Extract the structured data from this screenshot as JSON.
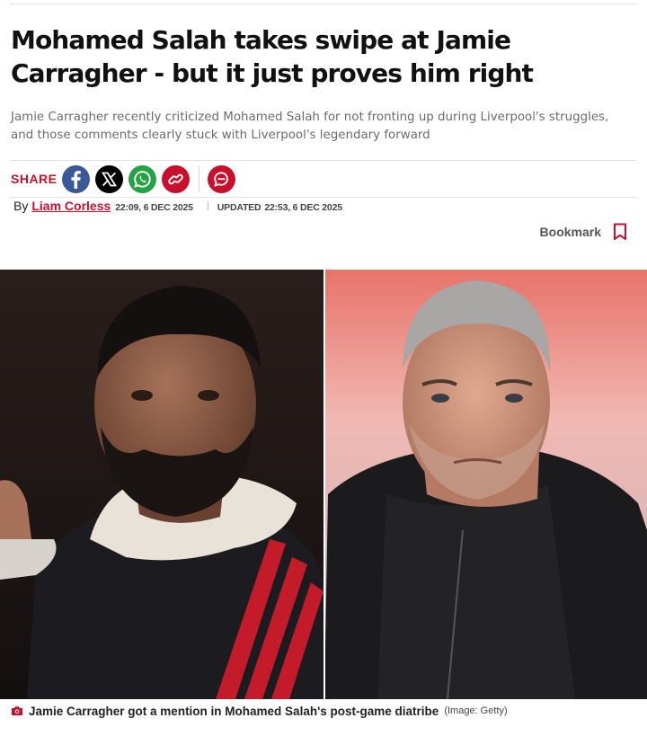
{
  "article": {
    "headline": "Mohamed Salah takes swipe at Jamie Carragher - but it just proves him right",
    "standfirst": "Jamie Carragher recently criticized Mohamed Salah for not fronting up during Liverpool's struggles, and those comments clearly stuck with Liverpool's legendary forward"
  },
  "share": {
    "label": "SHARE",
    "buttons": [
      {
        "name": "facebook",
        "icon": "facebook-icon",
        "color": "#3b5998"
      },
      {
        "name": "x",
        "icon": "x-icon",
        "color": "#000000"
      },
      {
        "name": "whatsapp",
        "icon": "whatsapp-icon",
        "color": "#25a244"
      },
      {
        "name": "copy-link",
        "icon": "link-icon",
        "color": "#c8102e"
      },
      {
        "name": "comments",
        "icon": "comment-icon",
        "color": "#c8102e"
      }
    ]
  },
  "byline": {
    "prefix": "By",
    "author": "Liam Corless",
    "published": "22:09, 6 DEC 2025",
    "updated_label": "UPDATED",
    "updated": "22:53, 6 DEC 2025"
  },
  "bookmark": {
    "label": "Bookmark",
    "icon": "bookmark-icon"
  },
  "hero": {
    "caption": "Jamie Carragher got a mention in Mohamed Salah's post-game diatribe",
    "credit": "(Image: Getty)",
    "caption_icon": "camera-icon"
  },
  "colors": {
    "brand_red": "#c8102e",
    "text": "#222222",
    "muted": "#6b6b6b"
  }
}
